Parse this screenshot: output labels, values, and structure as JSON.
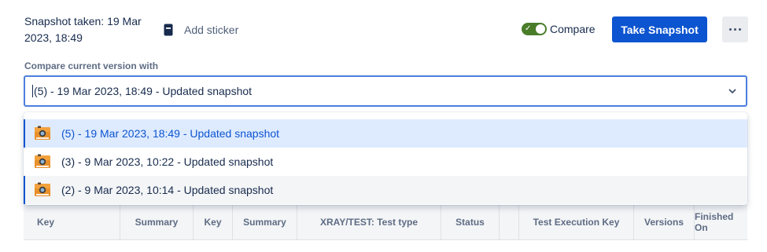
{
  "header": {
    "snapshot_title": "Snapshot taken: 19 Mar 2023, 18:49",
    "add_sticker_label": "Add sticker",
    "compare_label": "Compare",
    "compare_enabled": true,
    "take_snapshot_label": "Take Snapshot",
    "more_icon": "more-horizontal-icon"
  },
  "compare_select": {
    "label": "Compare current version with",
    "value": "(5) - 19 Mar 2023, 18:49 - Updated snapshot"
  },
  "dropdown": {
    "options": [
      {
        "label": "(5) - 19 Mar 2023, 18:49 - Updated snapshot",
        "state": "selected",
        "icon": "camera-icon"
      },
      {
        "label": "(3) - 9 Mar 2023, 10:22 - Updated snapshot",
        "state": "default",
        "icon": "camera-icon"
      },
      {
        "label": "(2) - 9 Mar 2023, 10:14 - Updated snapshot",
        "state": "hovered",
        "icon": "camera-icon"
      }
    ]
  },
  "table": {
    "columns": [
      "Key",
      "Summary",
      "Key",
      "Summary",
      "XRAY/TEST: Test type",
      "Status",
      "",
      "Test Execution Key",
      "Versions",
      "Finished On"
    ]
  },
  "colors": {
    "primary": "#0c54d0",
    "toggle_on": "#4a7d2a",
    "selected_bg": "#deebff",
    "hover_bg": "#f4f5f7"
  }
}
